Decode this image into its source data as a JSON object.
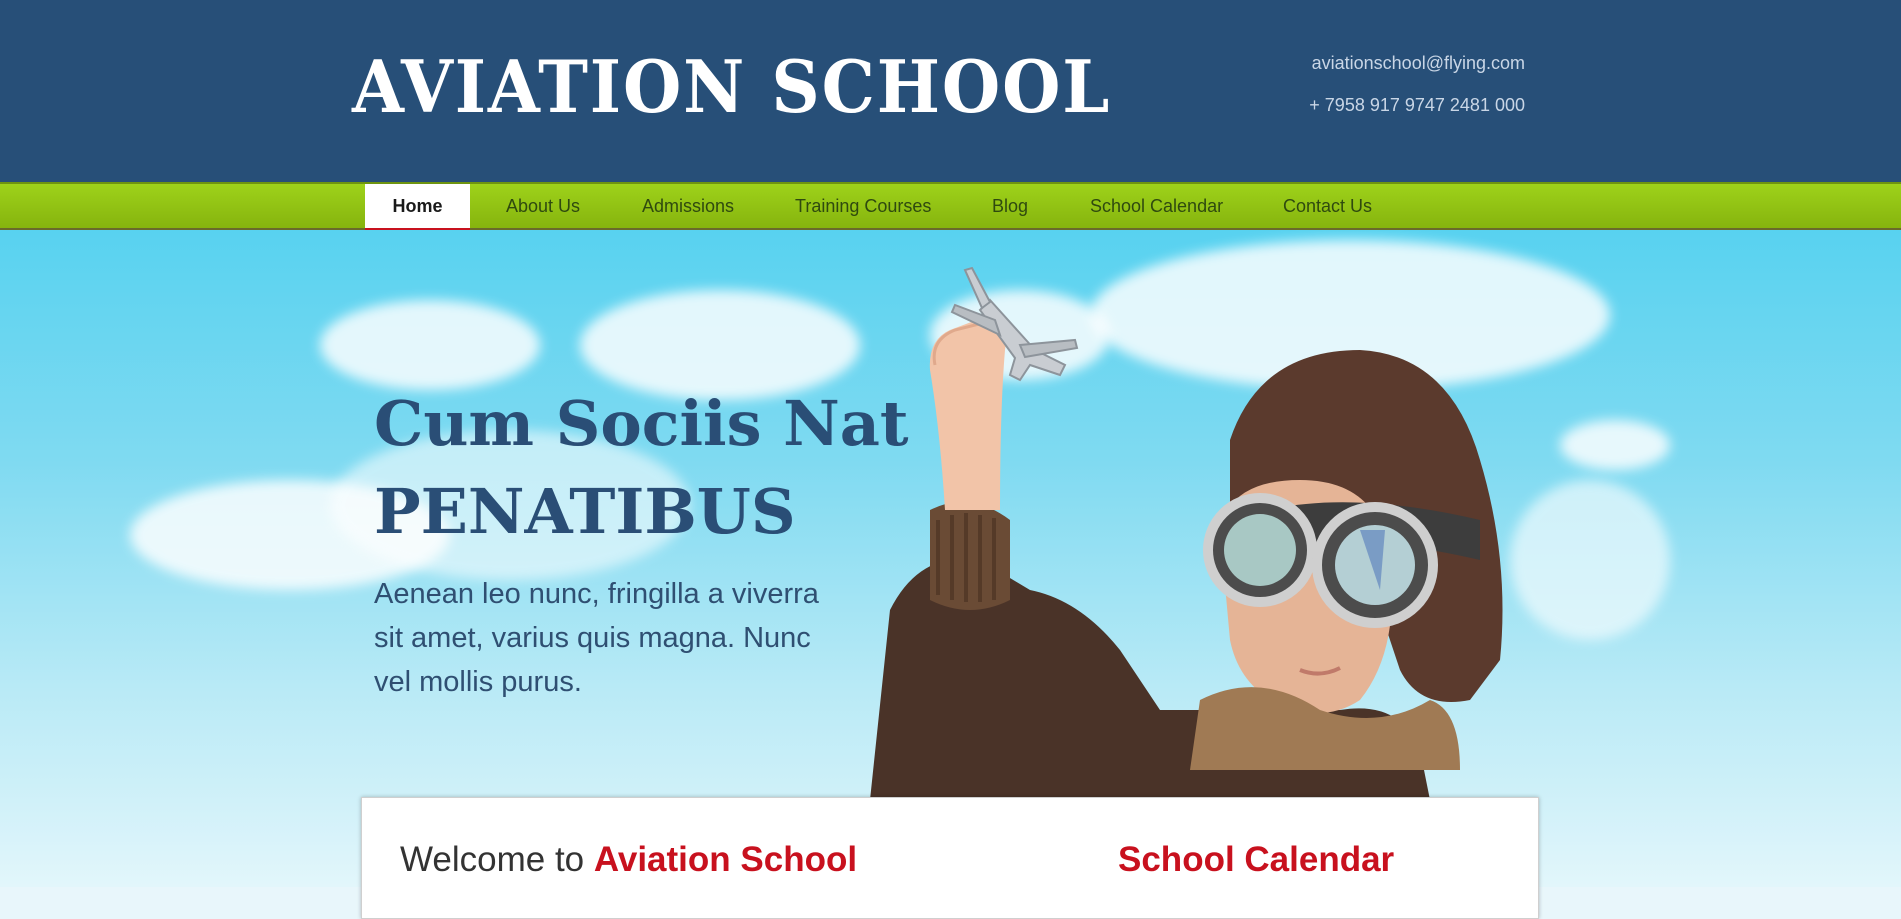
{
  "header": {
    "logo": "AVIATION SCHOOL",
    "email": "aviationschool@flying.com",
    "phone": "+ 7958 917 9747 2481 000"
  },
  "nav": {
    "items": [
      {
        "label": "Home",
        "active": true
      },
      {
        "label": "About Us",
        "active": false
      },
      {
        "label": "Admissions",
        "active": false
      },
      {
        "label": "Training Courses",
        "active": false
      },
      {
        "label": "Blog",
        "active": false
      },
      {
        "label": "School Calendar",
        "active": false
      },
      {
        "label": "Contact Us",
        "active": false
      }
    ]
  },
  "hero": {
    "title_line1": "Cum Sociis Nat",
    "title_line2": "PENATIBUS",
    "text": "Aenean leo nunc, fringilla a viverra sit amet, varius quis magna. Nunc vel mollis purus."
  },
  "content": {
    "welcome_prefix": "Welcome to",
    "welcome_accent": "Aviation School",
    "calendar_title": "School Calendar"
  },
  "colors": {
    "header_bg": "#274f78",
    "nav_green": "#8fc413",
    "accent_red": "#c8111e",
    "hero_title": "#2a4e76"
  }
}
